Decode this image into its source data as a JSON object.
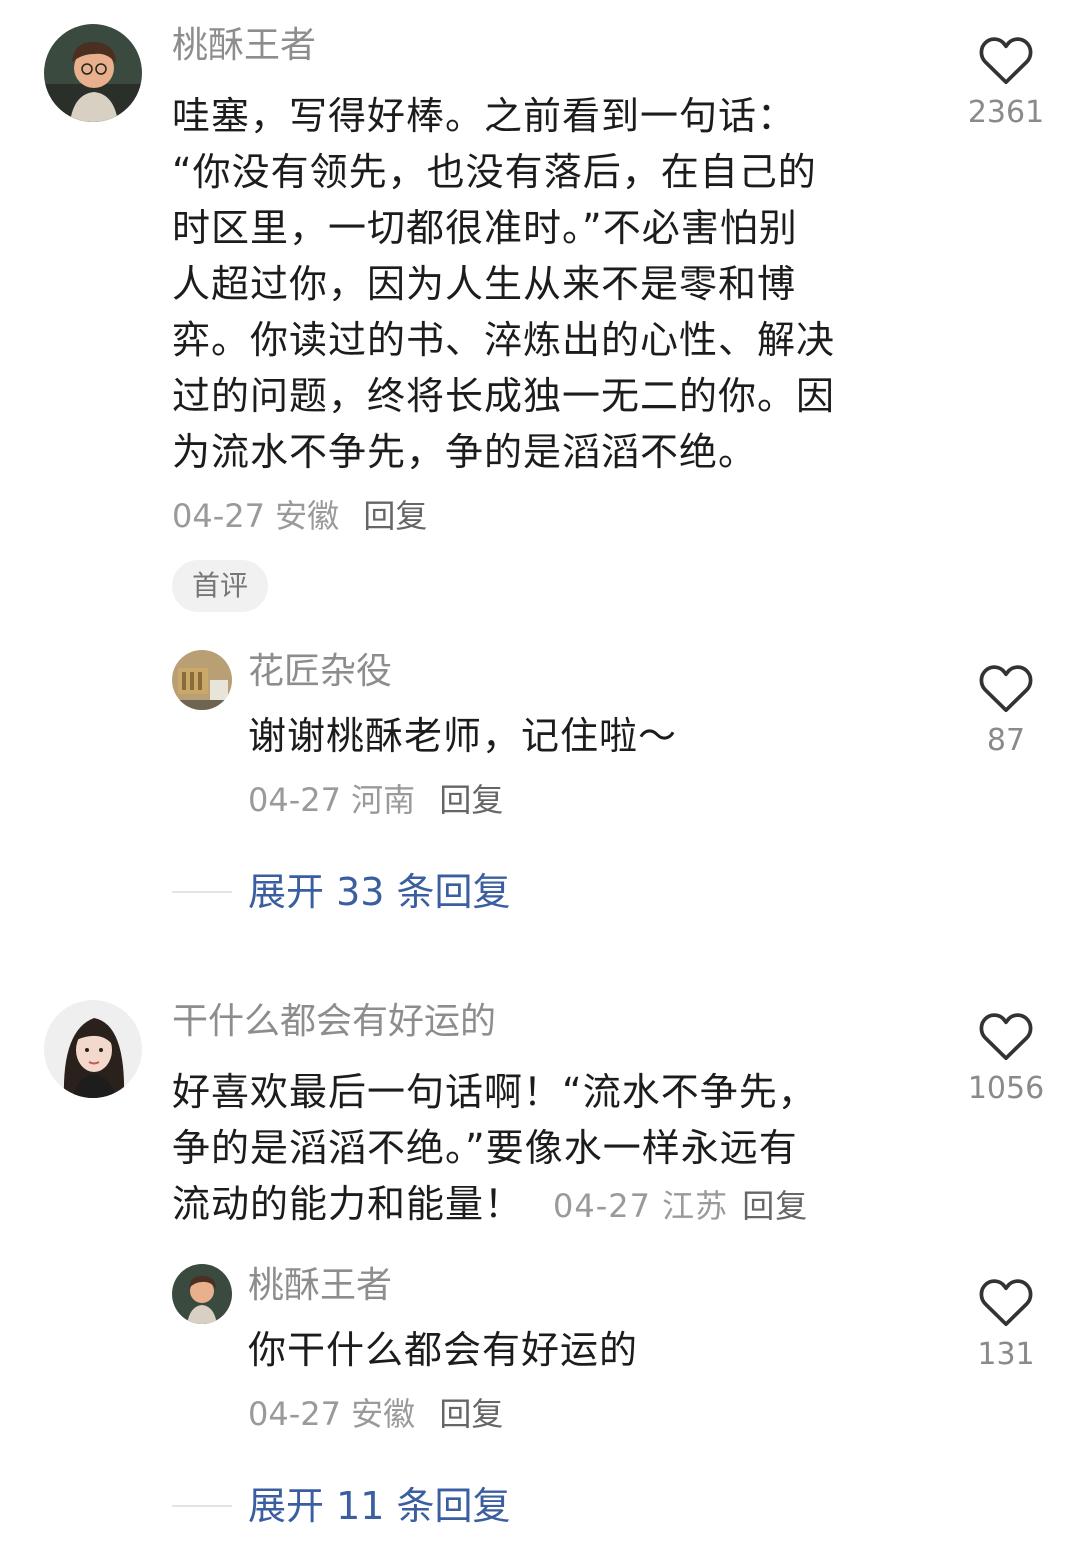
{
  "comments": [
    {
      "author": "桃酥王者",
      "body_lines": [
        "哇塞，写得好棒。之前看到一句话：",
        "“你没有领先，也没有落后，在自己的",
        "时区里，一切都很准时。”不必害怕别",
        "人超过你，因为人生从来不是零和博",
        "弈。你读过的书、淬炼出的心性、解决",
        "过的问题，终将长成独一无二的你。因",
        "为流水不争先，争的是滔滔不绝。"
      ],
      "date": "04-27",
      "location": "安徽",
      "reply_label": "回复",
      "badge": "首评",
      "likes": "2361",
      "reply": {
        "author": "花匠杂役",
        "body": "谢谢桃酥老师，记住啦～",
        "date": "04-27",
        "location": "河南",
        "reply_label": "回复",
        "likes": "87"
      },
      "expand_label": "展开 33 条回复"
    },
    {
      "author": "干什么都会有好运的",
      "body_lines": [
        "好喜欢最后一句话啊！“流水不争先，",
        "争的是滔滔不绝。”要像水一样永远有",
        "流动的能力和能量！"
      ],
      "date": "04-27",
      "location": "江苏",
      "reply_label": "回复",
      "likes": "1056",
      "reply": {
        "author": "桃酥王者",
        "body": "你干什么都会有好运的",
        "date": "04-27",
        "location": "安徽",
        "reply_label": "回复",
        "likes": "131"
      },
      "expand_label": "展开 11 条回复"
    }
  ],
  "icons": {
    "like": "heart-outline-icon"
  }
}
